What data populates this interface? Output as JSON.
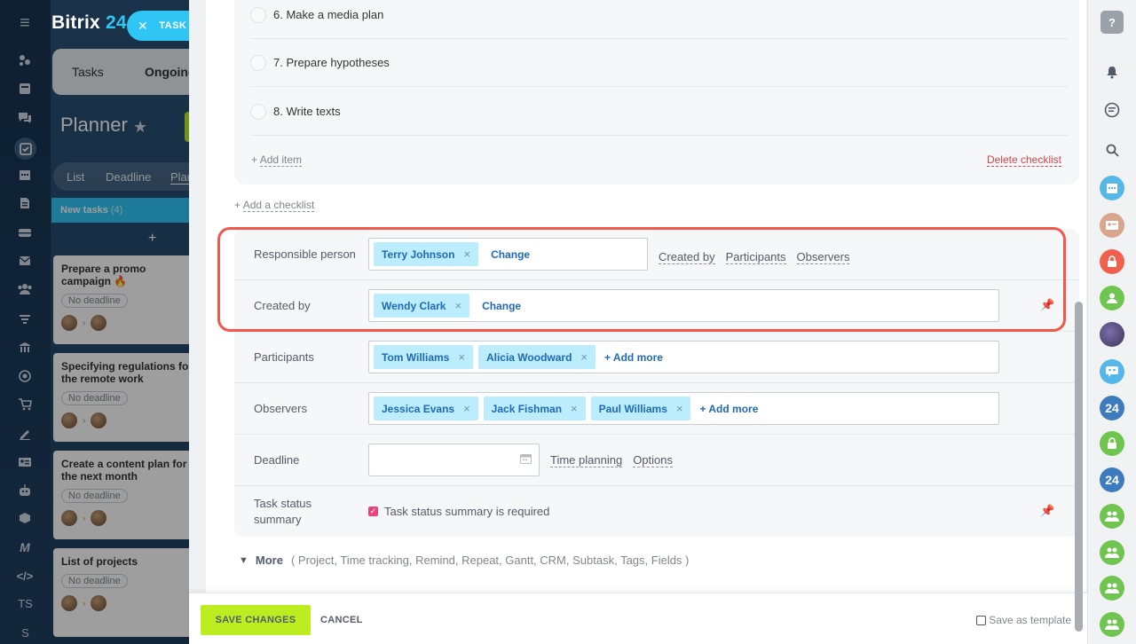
{
  "app": {
    "logo_text": "Bitrix",
    "logo_num": "24"
  },
  "task_pill": {
    "label": "TASK"
  },
  "background": {
    "tabs": [
      "Tasks",
      "Ongoing"
    ],
    "planner_title": "Planner",
    "view_tabs": [
      "List",
      "Deadline",
      "Plan"
    ],
    "column": {
      "title": "New tasks",
      "count": "(4)"
    },
    "cards": [
      {
        "title": "Prepare a promo campaign 🔥",
        "deadline": "No deadline"
      },
      {
        "title": "Specifying regulations for the remote work",
        "deadline": "No deadline"
      },
      {
        "title": "Create a content plan for the next month",
        "deadline": "No deadline"
      },
      {
        "title": "List of projects",
        "deadline": "No deadline"
      }
    ]
  },
  "leftnav": {
    "initials": "TS",
    "s": "S"
  },
  "checklist": {
    "items": [
      "6. Make a media plan",
      "7. Prepare hypotheses",
      "8. Write texts"
    ],
    "add_item": "+ Add item",
    "add_item_link": "Add item",
    "delete": "Delete checklist",
    "add_checklist_plus": "+",
    "add_checklist": "Add a checklist"
  },
  "fields": {
    "responsible": {
      "label": "Responsible person",
      "chip": "Terry Johnson",
      "change": "Change",
      "extra": [
        "Created by",
        "Participants",
        "Observers"
      ]
    },
    "created_by": {
      "label": "Created by",
      "chip": "Wendy Clark",
      "change": "Change"
    },
    "participants": {
      "label": "Participants",
      "chips": [
        "Tom Williams",
        "Alicia Woodward"
      ],
      "add": "+ Add more"
    },
    "observers": {
      "label": "Observers",
      "chips": [
        "Jessica Evans",
        "Jack Fishman",
        "Paul Williams"
      ],
      "add": "+ Add more"
    },
    "deadline": {
      "label": "Deadline",
      "value": "",
      "time_planning": "Time planning",
      "options": "Options"
    },
    "status_summary": {
      "label_line1": "Task status",
      "label_line2": "summary",
      "checkbox_label": "Task status summary is required",
      "checked": true
    }
  },
  "more": {
    "label": "More",
    "items": "( Project,  Time tracking,  Remind,  Repeat,  Gantt,  CRM,  Subtask,  Tags,  Fields )"
  },
  "footer": {
    "save": "SAVE CHANGES",
    "cancel": "CANCEL",
    "save_template": "Save as template"
  },
  "rightbar": {
    "help": "?",
    "badge24a": "24",
    "badge24b": "24"
  },
  "colors": {
    "accent": "#2fc6f6",
    "save": "#bbed21",
    "highlight": "#f4574a",
    "chip_bg": "#bcedfc",
    "link": "#1f6ab5"
  }
}
